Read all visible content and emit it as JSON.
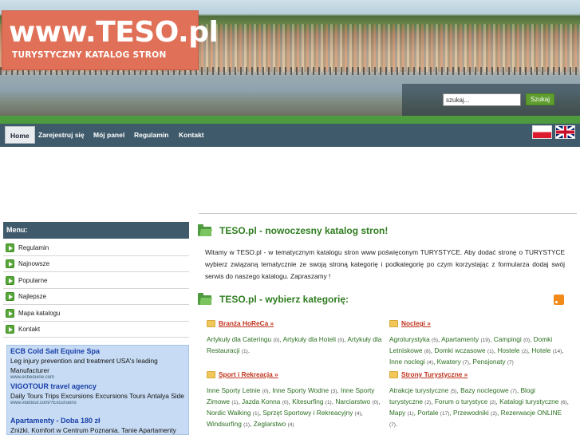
{
  "header": {
    "logo_main": "www.TESO.pl",
    "logo_sub": "TURYSTYCZNY KATALOG STRON",
    "search_placeholder": "szukaj...",
    "search_button": "Szukaj"
  },
  "nav": {
    "items": [
      "Home",
      "Zarejestruj się",
      "Mój panel",
      "Regulamin",
      "Kontakt"
    ]
  },
  "sidebar": {
    "menu_title": "Menu:",
    "items": [
      "Regulamin",
      "Najnowsze",
      "Popularne",
      "Najlepsze",
      "Mapa katalogu",
      "Kontakt"
    ],
    "ads": [
      {
        "title": "ECB Cold Salt Equine Spa",
        "desc": "Leg injury prevention and treatment USA's leading Manufacturer",
        "url": "www.ecbequine.com"
      },
      {
        "title": "VIGOTOUR travel agency",
        "desc": "Daily Tours Trips Excursions Excursions Tours Antalya Side",
        "url": "www.vigotour.com/?Excursions"
      },
      {
        "title": "Apartamenty - Doba 180 zł",
        "desc": "Zniżki. Komfort w Centrum Poznania. Tanie Apartamenty",
        "url": ""
      }
    ]
  },
  "main": {
    "welcome_title": "TESO.pl - nowoczesny katalog stron!",
    "welcome_text": "Witamy w TESO.pl - w tematycznym katalogu stron www poświęconym TURYSTYCE. Aby dodać stronę o TURYSTYCE wybierz związaną tematycznie ze swoją stroną kategorię i podkategorię po czym korzystając z formularza dodaj swój serwis do naszego katalogu. Zapraszamy !",
    "categories_title": "TESO.pl - wybierz kategorię:",
    "categories": [
      {
        "name": "Branża HoReCa »",
        "subs": [
          {
            "label": "Artykuły dla Cateringu",
            "count": "(0)"
          },
          {
            "label": "Artykuły dla Hoteli",
            "count": "(0)"
          },
          {
            "label": "Artykuły dla Restauracji",
            "count": "(1)"
          }
        ]
      },
      {
        "name": "Noclegi »",
        "subs": [
          {
            "label": "Agroturystyka",
            "count": "(5)"
          },
          {
            "label": "Apartamenty",
            "count": "(19)"
          },
          {
            "label": "Campingi",
            "count": "(0)"
          },
          {
            "label": "Domki Letniskowe",
            "count": "(8)"
          },
          {
            "label": "Domki wczasowe",
            "count": "(1)"
          },
          {
            "label": "Hostele",
            "count": "(2)"
          },
          {
            "label": "Hotele",
            "count": "(14)"
          },
          {
            "label": "Inne noclegi",
            "count": "(4)"
          },
          {
            "label": "Kwatery",
            "count": "(7)"
          },
          {
            "label": "Pensjonaty",
            "count": "(7)"
          }
        ]
      },
      {
        "name": "Sport i Rekreacja »",
        "subs": [
          {
            "label": "Inne Sporty Letnie",
            "count": "(0)"
          },
          {
            "label": "Inne Sporty Wodne",
            "count": "(3)"
          },
          {
            "label": "Inne Sporty Zimowe",
            "count": "(1)"
          },
          {
            "label": "Jazda Konna",
            "count": "(0)"
          },
          {
            "label": "Kitesurfing",
            "count": "(1)"
          },
          {
            "label": "Narciarstwo",
            "count": "(0)"
          },
          {
            "label": "Nordic Walking",
            "count": "(1)"
          },
          {
            "label": "Sprzęt Sportowy i Rekreacyjny",
            "count": "(4)"
          },
          {
            "label": "Windsurfing",
            "count": "(1)"
          },
          {
            "label": "Żeglarstwo",
            "count": "(4)"
          }
        ]
      },
      {
        "name": "Strony Turystyczne »",
        "subs": [
          {
            "label": "Atrakcje turystyczne",
            "count": "(5)"
          },
          {
            "label": "Bazy noclegowe",
            "count": "(7)"
          },
          {
            "label": "Blogi turystyczne",
            "count": "(2)"
          },
          {
            "label": "Forum o turystyce",
            "count": "(2)"
          },
          {
            "label": "Katalogi turystyczne",
            "count": "(6)"
          },
          {
            "label": "Mapy",
            "count": "(1)"
          },
          {
            "label": "Portale",
            "count": "(17)"
          },
          {
            "label": "Przewodniki",
            "count": "(2)"
          },
          {
            "label": "Rezerwacje ONLINE",
            "count": "(7)"
          }
        ]
      }
    ]
  },
  "colors": {
    "accent_green": "#4e9a3f",
    "nav_bg": "#3f5a6b",
    "logo_bg": "#e07158",
    "category_link": "#c0321c",
    "subcategory_link": "#2a6e1f",
    "ad_bg": "#c7dcf4"
  },
  "icons": {
    "menu_bullet": "green-arrow-icon",
    "section": "folder-icon",
    "category": "yellow-folder-icon",
    "feed": "rss-icon",
    "lang_pl": "flag-pl-icon",
    "lang_en": "flag-uk-icon"
  }
}
